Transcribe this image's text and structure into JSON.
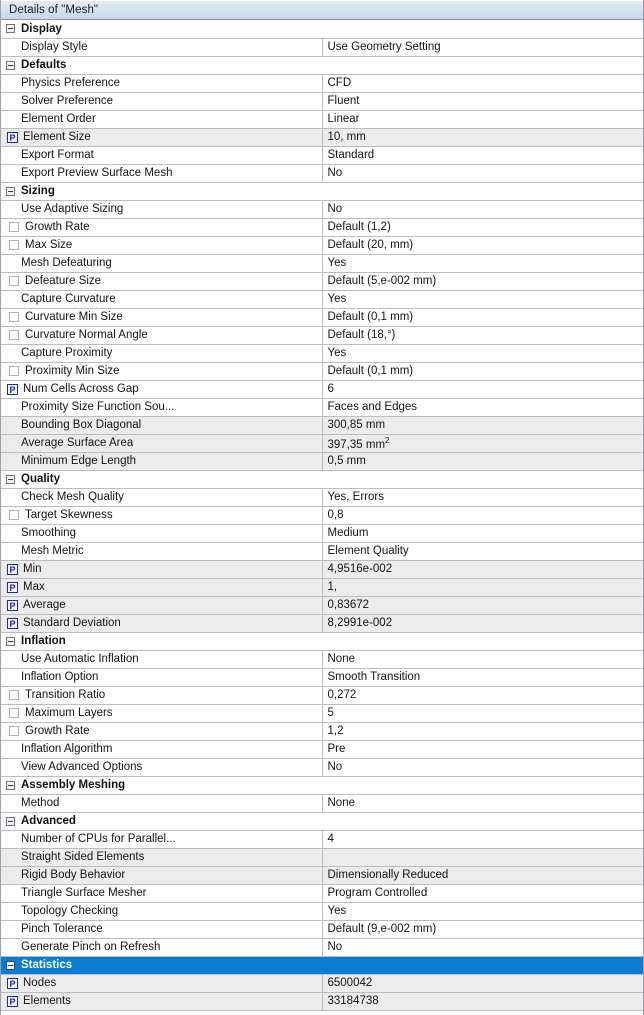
{
  "window": {
    "title": "Details of \"Mesh\"",
    "icon": "collapse-icon"
  },
  "colors": {
    "titlebar": "#d2e0ef",
    "selected_row": "#0a7cd4",
    "readonly_row": "#ececeb",
    "grid_line": "#b9bcc0",
    "parameter_badge": "#1414d2"
  },
  "rows": [
    {
      "type": "section",
      "label": "Display",
      "selected": false
    },
    {
      "type": "prop",
      "label": "Display Style",
      "value": "Use Geometry Setting",
      "indent": 0,
      "marker": "none",
      "readonly": false
    },
    {
      "type": "section",
      "label": "Defaults",
      "selected": false
    },
    {
      "type": "prop",
      "label": "Physics Preference",
      "value": "CFD",
      "indent": 0,
      "marker": "none",
      "readonly": false
    },
    {
      "type": "prop",
      "label": "Solver Preference",
      "value": "Fluent",
      "indent": 0,
      "marker": "none",
      "readonly": false
    },
    {
      "type": "prop",
      "label": "Element Order",
      "value": "Linear",
      "indent": 0,
      "marker": "none",
      "readonly": false
    },
    {
      "type": "prop",
      "label": "Element Size",
      "value": "10, mm",
      "indent": 0,
      "marker": "parameter",
      "readonly": true
    },
    {
      "type": "prop",
      "label": "Export Format",
      "value": "Standard",
      "indent": 0,
      "marker": "none",
      "readonly": false
    },
    {
      "type": "prop",
      "label": "Export Preview Surface Mesh",
      "value": "No",
      "indent": 0,
      "marker": "none",
      "readonly": false
    },
    {
      "type": "section",
      "label": "Sizing",
      "selected": false
    },
    {
      "type": "prop",
      "label": "Use Adaptive Sizing",
      "value": "No",
      "indent": 0,
      "marker": "none",
      "readonly": false
    },
    {
      "type": "prop",
      "label": "Growth Rate",
      "value": "Default (1,2)",
      "indent": 1,
      "marker": "checkbox",
      "readonly": false
    },
    {
      "type": "prop",
      "label": "Max Size",
      "value": "Default (20, mm)",
      "indent": 1,
      "marker": "checkbox",
      "readonly": false
    },
    {
      "type": "prop",
      "label": "Mesh Defeaturing",
      "value": "Yes",
      "indent": 0,
      "marker": "none",
      "readonly": false
    },
    {
      "type": "prop",
      "label": "Defeature Size",
      "value": "Default (5,e-002 mm)",
      "indent": 1,
      "marker": "checkbox",
      "readonly": false
    },
    {
      "type": "prop",
      "label": "Capture Curvature",
      "value": "Yes",
      "indent": 0,
      "marker": "none",
      "readonly": false
    },
    {
      "type": "prop",
      "label": "Curvature Min Size",
      "value": "Default (0,1 mm)",
      "indent": 1,
      "marker": "checkbox",
      "readonly": false
    },
    {
      "type": "prop",
      "label": "Curvature Normal Angle",
      "value": "Default (18,°)",
      "indent": 1,
      "marker": "checkbox",
      "readonly": false
    },
    {
      "type": "prop",
      "label": "Capture Proximity",
      "value": "Yes",
      "indent": 0,
      "marker": "none",
      "readonly": false
    },
    {
      "type": "prop",
      "label": "Proximity Min Size",
      "value": "Default (0,1 mm)",
      "indent": 1,
      "marker": "checkbox",
      "readonly": false
    },
    {
      "type": "prop",
      "label": "Num Cells Across Gap",
      "value": "6",
      "indent": 0,
      "marker": "parameter",
      "readonly": false
    },
    {
      "type": "prop",
      "label": "Proximity Size Function Sou...",
      "value": "Faces and Edges",
      "indent": 0,
      "marker": "none",
      "readonly": false
    },
    {
      "type": "prop",
      "label": "Bounding Box Diagonal",
      "value": "300,85 mm",
      "indent": 0,
      "marker": "none",
      "readonly": true
    },
    {
      "type": "prop",
      "label": "Average Surface Area",
      "value": "397,35 mm",
      "value_sup": "2",
      "indent": 0,
      "marker": "none",
      "readonly": true
    },
    {
      "type": "prop",
      "label": "Minimum Edge Length",
      "value": "0,5 mm",
      "indent": 0,
      "marker": "none",
      "readonly": true
    },
    {
      "type": "section",
      "label": "Quality",
      "selected": false
    },
    {
      "type": "prop",
      "label": "Check Mesh Quality",
      "value": "Yes, Errors",
      "indent": 0,
      "marker": "none",
      "readonly": false
    },
    {
      "type": "prop",
      "label": "Target Skewness",
      "value": "0,8",
      "indent": 1,
      "marker": "checkbox",
      "readonly": false
    },
    {
      "type": "prop",
      "label": "Smoothing",
      "value": "Medium",
      "indent": 0,
      "marker": "none",
      "readonly": false
    },
    {
      "type": "prop",
      "label": "Mesh Metric",
      "value": "Element Quality",
      "indent": 0,
      "marker": "none",
      "readonly": false
    },
    {
      "type": "prop",
      "label": "Min",
      "value": "4,9516e-002",
      "indent": 0,
      "marker": "parameter",
      "readonly": true
    },
    {
      "type": "prop",
      "label": "Max",
      "value": "1,",
      "indent": 0,
      "marker": "parameter",
      "readonly": true
    },
    {
      "type": "prop",
      "label": "Average",
      "value": "0,83672",
      "indent": 0,
      "marker": "parameter",
      "readonly": true
    },
    {
      "type": "prop",
      "label": "Standard Deviation",
      "value": "8,2991e-002",
      "indent": 0,
      "marker": "parameter",
      "readonly": true
    },
    {
      "type": "section",
      "label": "Inflation",
      "selected": false
    },
    {
      "type": "prop",
      "label": "Use Automatic Inflation",
      "value": "None",
      "indent": 0,
      "marker": "none",
      "readonly": false
    },
    {
      "type": "prop",
      "label": "Inflation Option",
      "value": "Smooth Transition",
      "indent": 0,
      "marker": "none",
      "readonly": false
    },
    {
      "type": "prop",
      "label": "Transition Ratio",
      "value": "0,272",
      "indent": 1,
      "marker": "checkbox",
      "readonly": false
    },
    {
      "type": "prop",
      "label": "Maximum Layers",
      "value": "5",
      "indent": 1,
      "marker": "checkbox",
      "readonly": false
    },
    {
      "type": "prop",
      "label": "Growth Rate",
      "value": "1,2",
      "indent": 1,
      "marker": "checkbox",
      "readonly": false
    },
    {
      "type": "prop",
      "label": "Inflation Algorithm",
      "value": "Pre",
      "indent": 0,
      "marker": "none",
      "readonly": false
    },
    {
      "type": "prop",
      "label": "View Advanced Options",
      "value": "No",
      "indent": 0,
      "marker": "none",
      "readonly": false
    },
    {
      "type": "section",
      "label": "Assembly Meshing",
      "selected": false
    },
    {
      "type": "prop",
      "label": "Method",
      "value": "None",
      "indent": 0,
      "marker": "none",
      "readonly": false
    },
    {
      "type": "section",
      "label": "Advanced",
      "selected": false
    },
    {
      "type": "prop",
      "label": "Number of CPUs for Parallel...",
      "value": "4",
      "indent": 0,
      "marker": "none",
      "readonly": false
    },
    {
      "type": "prop",
      "label": "Straight Sided Elements",
      "value": "",
      "indent": 0,
      "marker": "none",
      "readonly": true
    },
    {
      "type": "prop",
      "label": "Rigid Body Behavior",
      "value": "Dimensionally Reduced",
      "indent": 0,
      "marker": "none",
      "readonly": true
    },
    {
      "type": "prop",
      "label": "Triangle Surface Mesher",
      "value": "Program Controlled",
      "indent": 0,
      "marker": "none",
      "readonly": false
    },
    {
      "type": "prop",
      "label": "Topology Checking",
      "value": "Yes",
      "indent": 0,
      "marker": "none",
      "readonly": false
    },
    {
      "type": "prop",
      "label": "Pinch Tolerance",
      "value": "Default (9,e-002 mm)",
      "indent": 0,
      "marker": "none",
      "readonly": false
    },
    {
      "type": "prop",
      "label": "Generate Pinch on Refresh",
      "value": "No",
      "indent": 0,
      "marker": "none",
      "readonly": false
    },
    {
      "type": "section",
      "label": "Statistics",
      "selected": true
    },
    {
      "type": "prop",
      "label": "Nodes",
      "value": "6500042",
      "indent": 0,
      "marker": "parameter",
      "readonly": true
    },
    {
      "type": "prop",
      "label": "Elements",
      "value": "33184738",
      "indent": 0,
      "marker": "parameter",
      "readonly": true
    }
  ]
}
